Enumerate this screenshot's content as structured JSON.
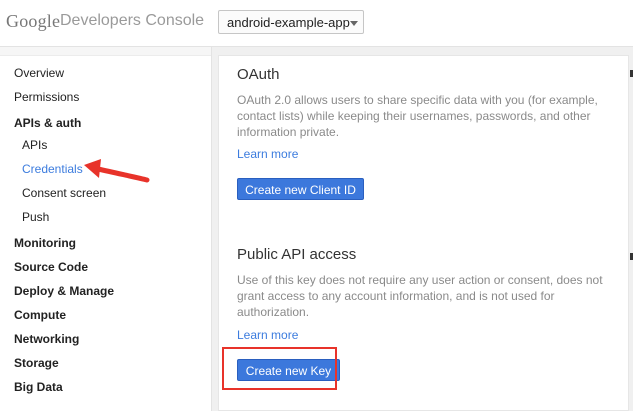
{
  "header": {
    "logo": "Google",
    "title": "Developers Console",
    "project": "android-example-app"
  },
  "sidebar": {
    "items": [
      {
        "label": "Overview"
      },
      {
        "label": "Permissions"
      },
      {
        "label": "APIs & auth"
      },
      {
        "label": "APIs"
      },
      {
        "label": "Credentials"
      },
      {
        "label": "Consent screen"
      },
      {
        "label": "Push"
      },
      {
        "label": "Monitoring"
      },
      {
        "label": "Source Code"
      },
      {
        "label": "Deploy & Manage"
      },
      {
        "label": "Compute"
      },
      {
        "label": "Networking"
      },
      {
        "label": "Storage"
      },
      {
        "label": "Big Data"
      }
    ]
  },
  "main": {
    "oauth": {
      "title": "OAuth",
      "description": "OAuth 2.0 allows users to share specific data with you (for example, contact lists) while keeping their usernames, passwords, and other information private.",
      "learn_more": "Learn more",
      "button": "Create new Client ID"
    },
    "public_api": {
      "title": "Public API access",
      "description": "Use of this key does not require any user action or consent, does not grant access to any account information, and is not used for authorization.",
      "learn_more": "Learn more",
      "button": "Create new Key"
    }
  },
  "colors": {
    "accent": "#3c78dc",
    "annotation": "#e8332a"
  }
}
